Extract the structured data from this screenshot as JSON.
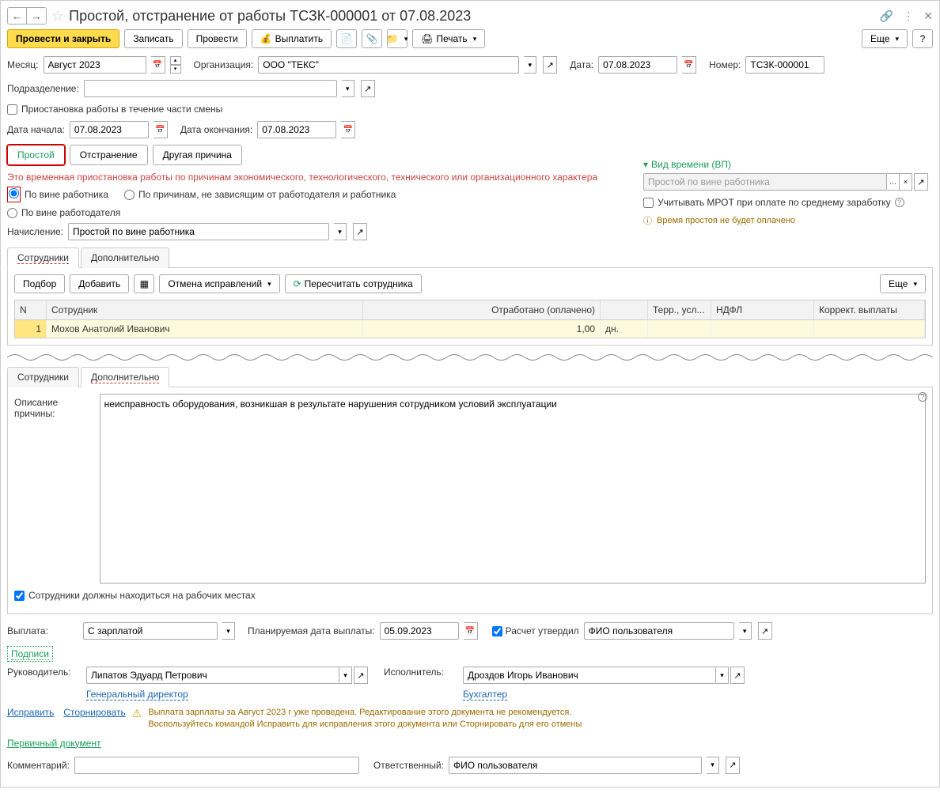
{
  "title": "Простой, отстранение от работы ТСЗК-000001 от 07.08.2023",
  "toolbar": {
    "post_close": "Провести и закрыть",
    "write": "Записать",
    "post": "Провести",
    "payout": "Выплатить",
    "print": "Печать",
    "more": "Еще"
  },
  "form": {
    "month_label": "Месяц:",
    "month_value": "Август 2023",
    "org_label": "Организация:",
    "org_value": "ООО \"ТЕКС\"",
    "date_label": "Дата:",
    "date_value": "07.08.2023",
    "number_label": "Номер:",
    "number_value": "ТСЗК-000001",
    "dept_label": "Подразделение:",
    "dept_value": "",
    "partial_shift": "Приостановка работы в течение части смены",
    "start_label": "Дата начала:",
    "start_value": "07.08.2023",
    "end_label": "Дата окончания:",
    "end_value": "07.08.2023"
  },
  "tabs1": {
    "idle": "Простой",
    "suspend": "Отстранение",
    "other": "Другая причина"
  },
  "red_note": "Это временная приостановка работы по причинам экономического, технологического, технического или организационного характера",
  "radios": {
    "r1": "По вине работника",
    "r2": "По причинам, не зависящим от работодателя и работника",
    "r3": "По вине работодателя"
  },
  "accrual": {
    "label": "Начисление:",
    "value": "Простой по вине работника"
  },
  "right": {
    "time_type": "Вид времени (ВП)",
    "time_placeholder": "Простой по вине работника",
    "mrot": "Учитывать МРОТ при оплате по среднему заработку",
    "not_paid": "Время простоя не будет оплачено"
  },
  "tabs2": {
    "employees": "Сотрудники",
    "more": "Дополнительно"
  },
  "sub": {
    "pick": "Подбор",
    "add": "Добавить",
    "cancel_fix": "Отмена исправлений",
    "recalc": "Пересчитать сотрудника",
    "more": "Еще"
  },
  "grid": {
    "h_n": "N",
    "h_emp": "Сотрудник",
    "h_worked": "Отработано (оплачено)",
    "h_terr": "Терр., усл...",
    "h_ndfl": "НДФЛ",
    "h_corr": "Коррект. выплаты",
    "row1": {
      "n": "1",
      "emp": "Мохов Анатолий Иванович",
      "worked": "1,00",
      "unit": "дн."
    }
  },
  "extra": {
    "desc_label": "Описание причины:",
    "desc_value": "неисправность оборудования, возникшая в результате нарушения сотрудником условий эксплуатации",
    "onsite": "Сотрудники должны находиться на рабочих местах"
  },
  "payout": {
    "label": "Выплата:",
    "value": "С зарплатой",
    "plan_label": "Планируемая дата выплаты:",
    "plan_value": "05.09.2023",
    "approved": "Расчет утвердил",
    "approver": "ФИО пользователя"
  },
  "sig": {
    "head": "Подписи",
    "mgr_label": "Руководитель:",
    "mgr_value": "Липатов Эдуард Петрович",
    "mgr_pos": "Генеральный директор",
    "exec_label": "Исполнитель:",
    "exec_value": "Дроздов Игорь Иванович",
    "exec_pos": "Бухгалтер"
  },
  "links": {
    "fix": "Исправить",
    "storno": "Сторнировать",
    "primary": "Первичный документ"
  },
  "warn": {
    "line1": "Выплата зарплаты за Август 2023 г уже проведена. Редактирование этого документа не рекомендуется.",
    "line2": "Воспользуйтесь командой Исправить для исправления этого документа или Сторнировать для его отмены"
  },
  "bottom": {
    "comment_label": "Комментарий:",
    "resp_label": "Ответственный:",
    "resp_value": "ФИО пользователя"
  }
}
